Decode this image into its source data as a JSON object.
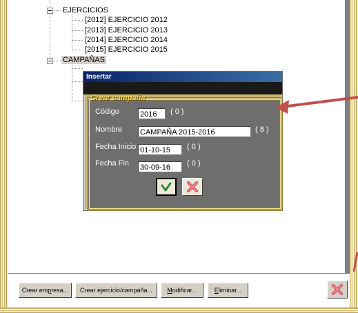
{
  "tree": {
    "items": [
      {
        "label": "EJERCICIOS"
      },
      {
        "label": "[2012] EJERCICIO 2012"
      },
      {
        "label": "[2013] EJERCICIO 2013"
      },
      {
        "label": "[2014] EJERCICIO 2014"
      },
      {
        "label": "[2015] EJERCICIO 2015"
      },
      {
        "label": "CAMPAÑAS"
      }
    ]
  },
  "dialog": {
    "title": "Insertar",
    "group_caption": "Crear campaña",
    "fields": {
      "codigo": {
        "label": "Código",
        "value": "2016",
        "count": "( 0 )"
      },
      "nombre": {
        "label": "Nombre",
        "value": "CAMPAÑA 2015-2016",
        "count": "( 8 )"
      },
      "fecha_inicio": {
        "label": "Fecha Inicio",
        "value": "01-10-15",
        "count": "( 0 )"
      },
      "fecha_fin": {
        "label": "Fecha Fin",
        "value": "30-09-16",
        "count": "( 0 )"
      }
    }
  },
  "toolbar": {
    "crear_empresa": {
      "pre": "Crear em",
      "u": "p",
      "post": "resa..."
    },
    "crear_ejercicio": {
      "pre": "Crear ejercicio/campaña...",
      "u": "",
      "post": ""
    },
    "modificar": {
      "pre": "",
      "u": "M",
      "post": "odificar..."
    },
    "eliminar": {
      "pre": "",
      "u": "E",
      "post": "liminar..."
    }
  },
  "colors": {
    "arrow": "#c0504d",
    "title_start": "#0a246a",
    "accept_check": "#2e8b2e",
    "cancel_x": "#e04050"
  },
  "icons": {
    "accept": "check-icon",
    "cancel": "cancel-x-icon"
  }
}
